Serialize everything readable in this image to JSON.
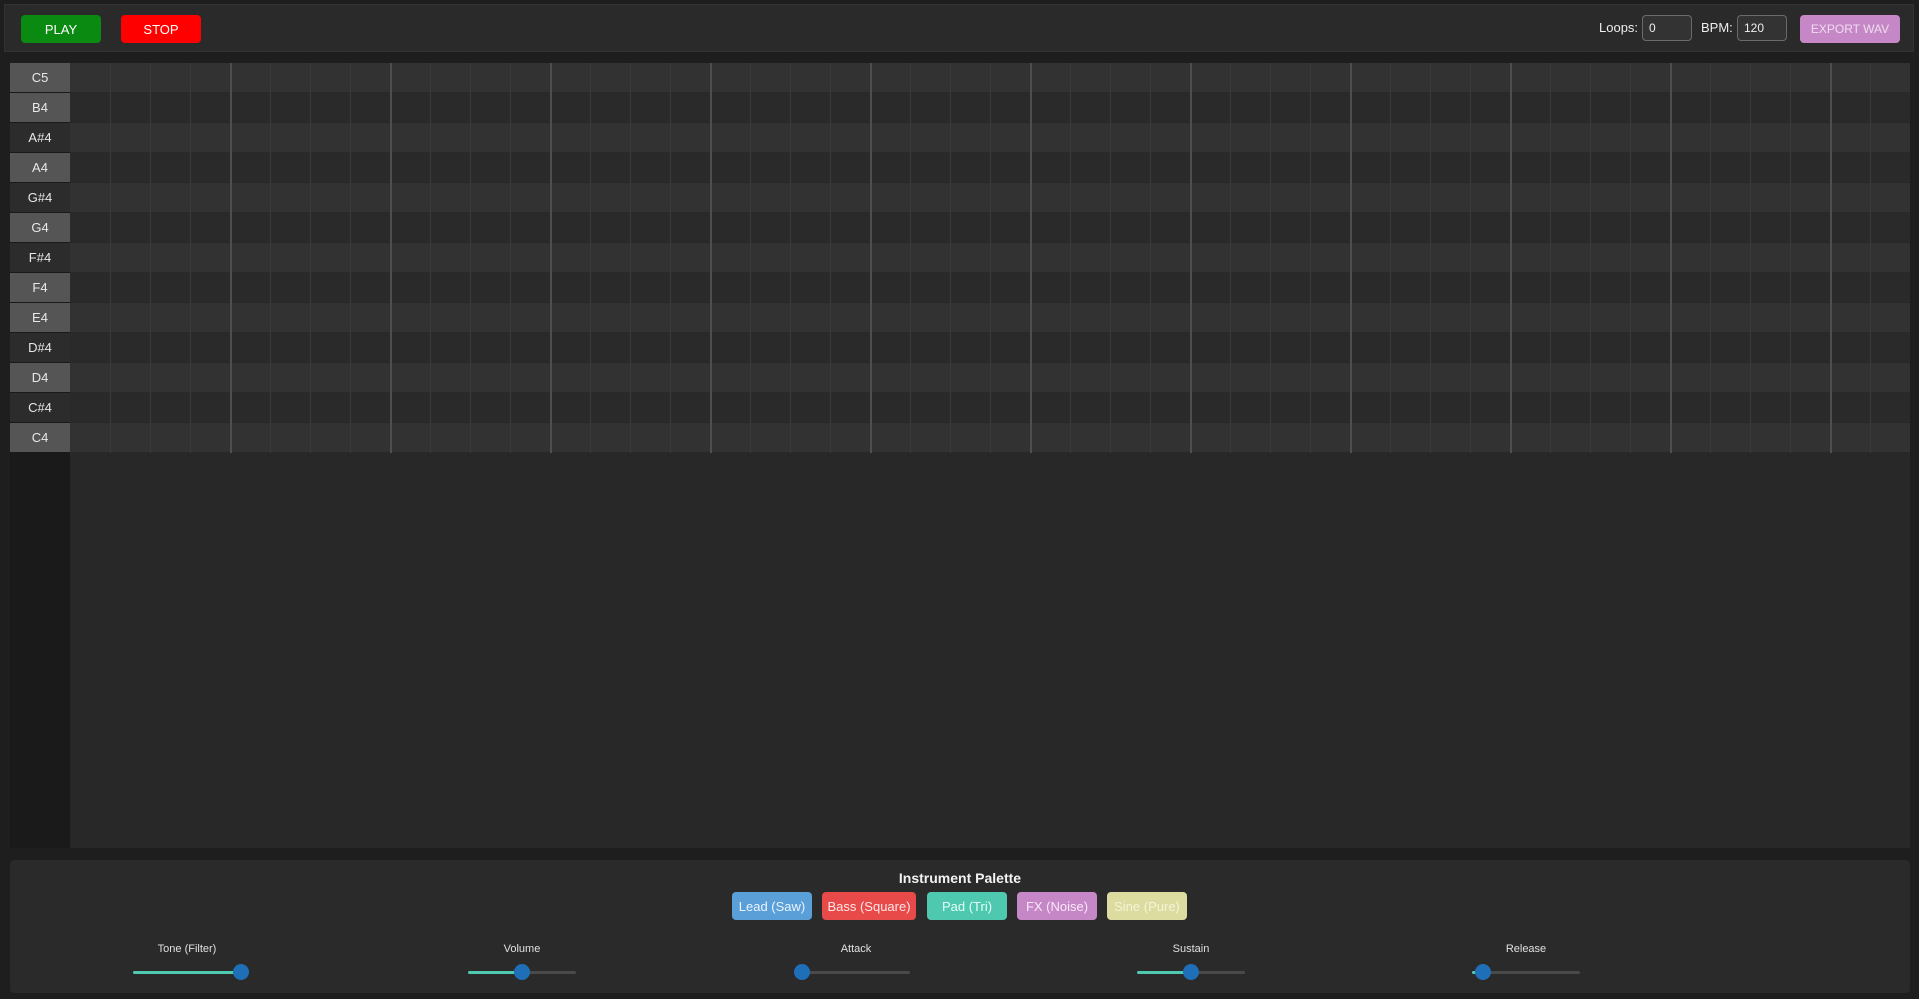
{
  "toolbar": {
    "play_label": "PLAY",
    "stop_label": "STOP",
    "loops_label": "Loops:",
    "loops_value": "0",
    "bpm_label": "BPM:",
    "bpm_value": "120",
    "export_label": "EXPORT WAV"
  },
  "piano_roll": {
    "notes": [
      {
        "label": "C5",
        "kind": "white"
      },
      {
        "label": "B4",
        "kind": "white"
      },
      {
        "label": "A#4",
        "kind": "black"
      },
      {
        "label": "A4",
        "kind": "white"
      },
      {
        "label": "G#4",
        "kind": "black"
      },
      {
        "label": "G4",
        "kind": "white"
      },
      {
        "label": "F#4",
        "kind": "black"
      },
      {
        "label": "F4",
        "kind": "white"
      },
      {
        "label": "E4",
        "kind": "white"
      },
      {
        "label": "D#4",
        "kind": "black"
      },
      {
        "label": "D4",
        "kind": "white"
      },
      {
        "label": "C#4",
        "kind": "black"
      },
      {
        "label": "C4",
        "kind": "white"
      }
    ],
    "steps": 46,
    "steps_per_bar": 4
  },
  "palette": {
    "title": "Instrument Palette",
    "instruments": [
      {
        "label": "Lead (Saw)",
        "color": "#5a9fd8",
        "text": "#eaf4ff"
      },
      {
        "label": "Bass (Square)",
        "color": "#e84a4a",
        "text": "#ffe8e8"
      },
      {
        "label": "Pad (Tri)",
        "color": "#4ec9b0",
        "text": "#e4fff8"
      },
      {
        "label": "FX (Noise)",
        "color": "#c587c6",
        "text": "#fbe8fb"
      },
      {
        "label": "Sine (Pure)",
        "color": "#dcdca0",
        "text": "#f4f4d8"
      }
    ],
    "sliders": [
      {
        "label": "Tone (Filter)",
        "value": 1.0
      },
      {
        "label": "Volume",
        "value": 0.5
      },
      {
        "label": "Attack",
        "value": 0.0
      },
      {
        "label": "Sustain",
        "value": 0.5
      },
      {
        "label": "Release",
        "value": 0.1
      }
    ]
  }
}
